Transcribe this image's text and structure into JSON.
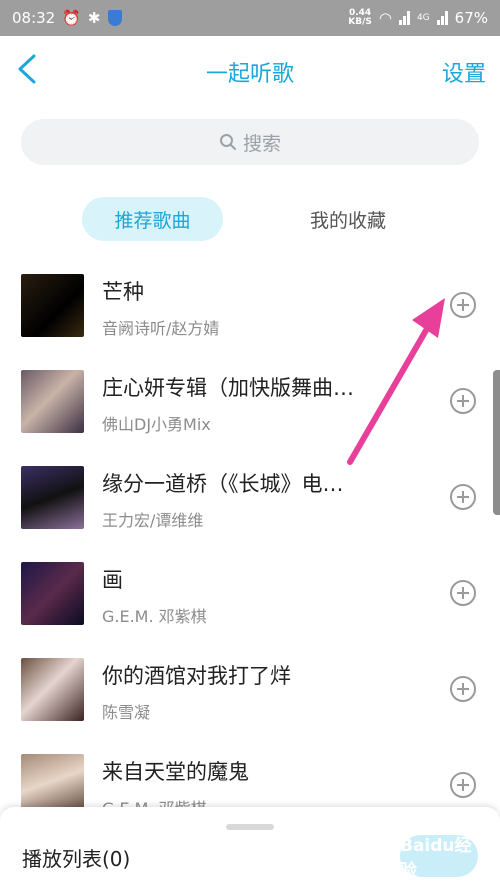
{
  "status_bar": {
    "time": "08:32",
    "net_speed_value": "0.44",
    "net_speed_unit": "KB/S",
    "network_type": "4G",
    "battery": "67%"
  },
  "header": {
    "title": "一起听歌",
    "settings_label": "设置"
  },
  "search": {
    "placeholder": "搜索"
  },
  "tabs": [
    {
      "label": "推荐歌曲",
      "active": true
    },
    {
      "label": "我的收藏",
      "active": false
    }
  ],
  "songs": [
    {
      "title": "芒种",
      "artist": "音阙诗听/赵方婧"
    },
    {
      "title": "庄心妍专辑（加快版舞曲…",
      "artist": "佛山DJ小勇Mix"
    },
    {
      "title": "缘分一道桥（《长城》电…",
      "artist": "王力宏/谭维维"
    },
    {
      "title": "画",
      "artist": "G.E.M. 邓紫棋"
    },
    {
      "title": "你的酒馆对我打了烊",
      "artist": "陈雪凝"
    },
    {
      "title": "来自天堂的魔鬼",
      "artist": "G.E.M. 邓紫棋"
    }
  ],
  "bottom_panel": {
    "playlist_label": "播放列表(0)",
    "watermark_text": "Baidu经验"
  },
  "colors": {
    "accent": "#1aa7d9",
    "arrow": "#e8409a"
  }
}
